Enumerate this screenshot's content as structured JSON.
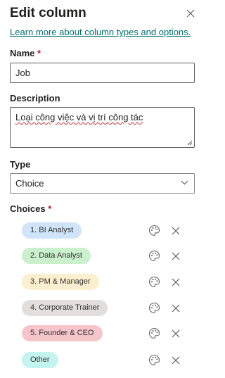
{
  "panel": {
    "title": "Edit column",
    "learn_more": "Learn more about column types and options."
  },
  "name": {
    "label": "Name",
    "required_marker": "*",
    "value": "Job"
  },
  "description": {
    "label": "Description",
    "value": "Loại công việc và vị trí công tác"
  },
  "type": {
    "label": "Type",
    "selected": "Choice"
  },
  "choices": {
    "label": "Choices",
    "required_marker": "*",
    "items": [
      {
        "label": "1. BI Analyst",
        "color": "#cfe4fa"
      },
      {
        "label": "2. Data Analyst",
        "color": "#caf0cc"
      },
      {
        "label": "3. PM & Manager",
        "color": "#fcefd0"
      },
      {
        "label": "4. Corporate Trainer",
        "color": "#e1dfdd"
      },
      {
        "label": "5. Founder & CEO",
        "color": "#f6c5cb"
      },
      {
        "label": "Other",
        "color": "#c4f4f0"
      }
    ]
  },
  "icons": {
    "close": "close-icon",
    "dropdown": "chevron-down-icon",
    "palette": "palette-icon",
    "remove": "close-icon"
  }
}
